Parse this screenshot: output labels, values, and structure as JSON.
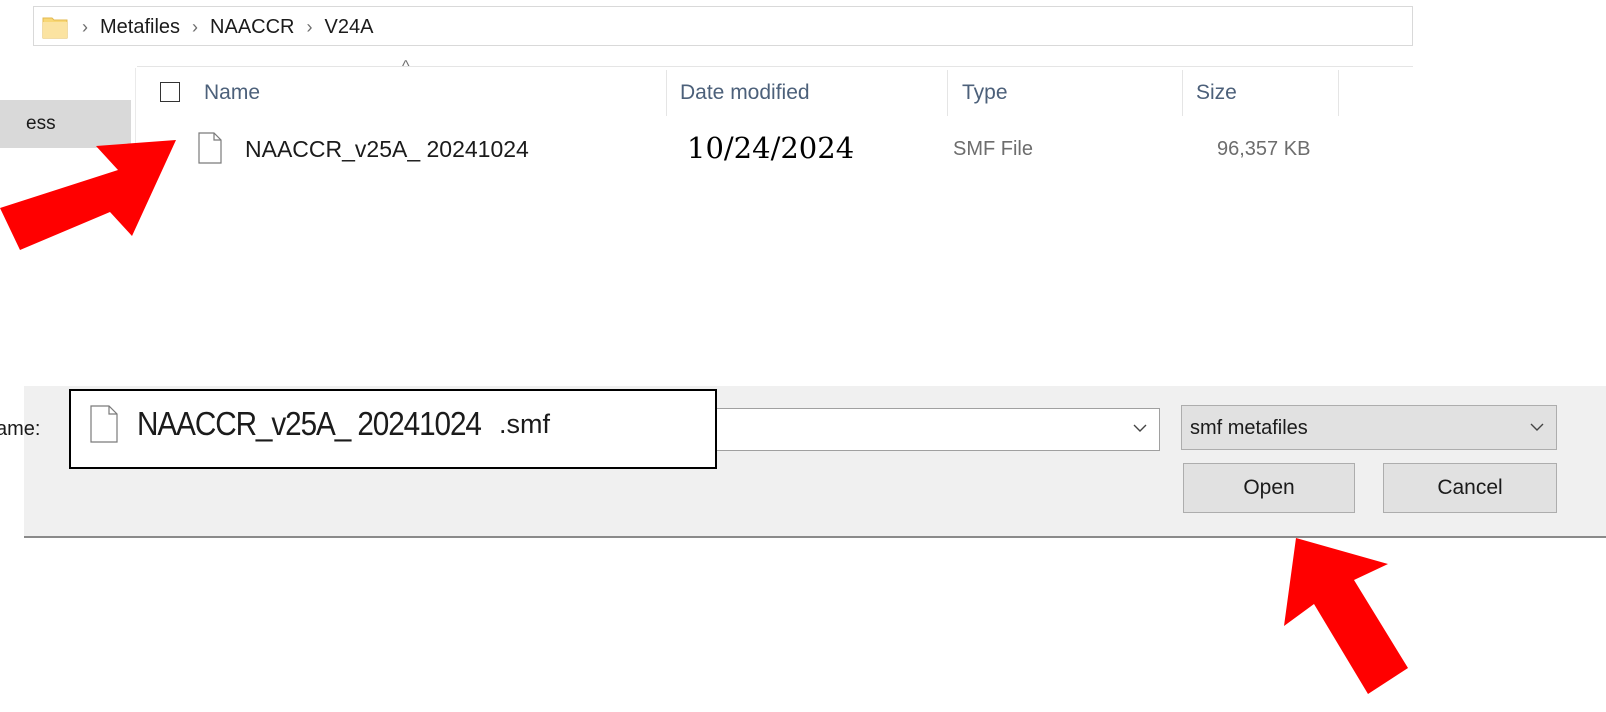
{
  "address_bar": {
    "crumbs": [
      "Metafiles",
      "NAACCR",
      "V24A"
    ],
    "separator": "›"
  },
  "nav": {
    "partial_item": "ess"
  },
  "columns": {
    "name": "Name",
    "date_modified": "Date modified",
    "type": "Type",
    "size": "Size",
    "sort_indicator": "^"
  },
  "file": {
    "name": "NAACCR_v25A_ 20241024",
    "date_modified": "10/24/2024",
    "type": "SMF File",
    "size": "96,357 KB"
  },
  "save_panel": {
    "filename_label": "ame:",
    "filename_base": "NAACCR_v25A_ 20241024",
    "filename_ext": ".smf",
    "filetype_value": "smf metafiles",
    "open_label": "Open",
    "cancel_label": "Cancel"
  },
  "colors": {
    "annotation_arrow": "#ff0000",
    "header_text": "#4c607a",
    "panel_bg": "#f0f0f0",
    "button_bg": "#e1e1e1",
    "folder_yellow": "#f8d775"
  }
}
